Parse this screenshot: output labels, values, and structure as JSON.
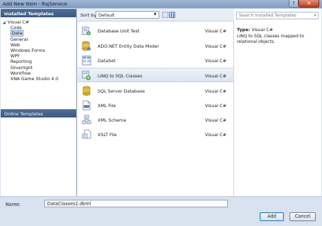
{
  "window": {
    "title": "Add New Item - RajService",
    "close": "✕",
    "help": "?"
  },
  "left": {
    "header": "Installed Templates",
    "root": "Visual C#",
    "items": [
      "Code",
      "Data",
      "General",
      "Web",
      "Windows Forms",
      "WPF",
      "Reporting",
      "Silverlight",
      "Workflow",
      "XNA Game Studio 4.0"
    ],
    "selected_index": 1,
    "online": "Online Templates"
  },
  "toolbar": {
    "sort_label": "Sort by:",
    "sort_value": "Default"
  },
  "list": {
    "rows": [
      {
        "name": "Database Unit Test",
        "lang": "Visual C#",
        "icon": "database-unit-test-icon"
      },
      {
        "name": "ADO.NET Entity Data Model",
        "lang": "Visual C#",
        "icon": "entity-model-icon"
      },
      {
        "name": "DataSet",
        "lang": "Visual C#",
        "icon": "dataset-icon"
      },
      {
        "name": "LINQ to SQL Classes",
        "lang": "Visual C#",
        "icon": "linq-to-sql-icon"
      },
      {
        "name": "SQL Server Database",
        "lang": "Visual C#",
        "icon": "sql-database-icon"
      },
      {
        "name": "XML File",
        "lang": "Visual C#",
        "icon": "xml-file-icon"
      },
      {
        "name": "XML Schema",
        "lang": "Visual C#",
        "icon": "xml-schema-icon"
      },
      {
        "name": "XSLT File",
        "lang": "Visual C#",
        "icon": "xslt-file-icon"
      }
    ],
    "selected_index": 3
  },
  "right": {
    "search_placeholder": "Search Installed Templates",
    "type_label": "Type:",
    "type_value": "Visual C#",
    "description": "LINQ to SQL classes mapped to relational objects."
  },
  "bottom": {
    "name_label": "Name:",
    "name_value": "DataClasses2.dbml",
    "add": "Add",
    "cancel": "Cancel"
  }
}
